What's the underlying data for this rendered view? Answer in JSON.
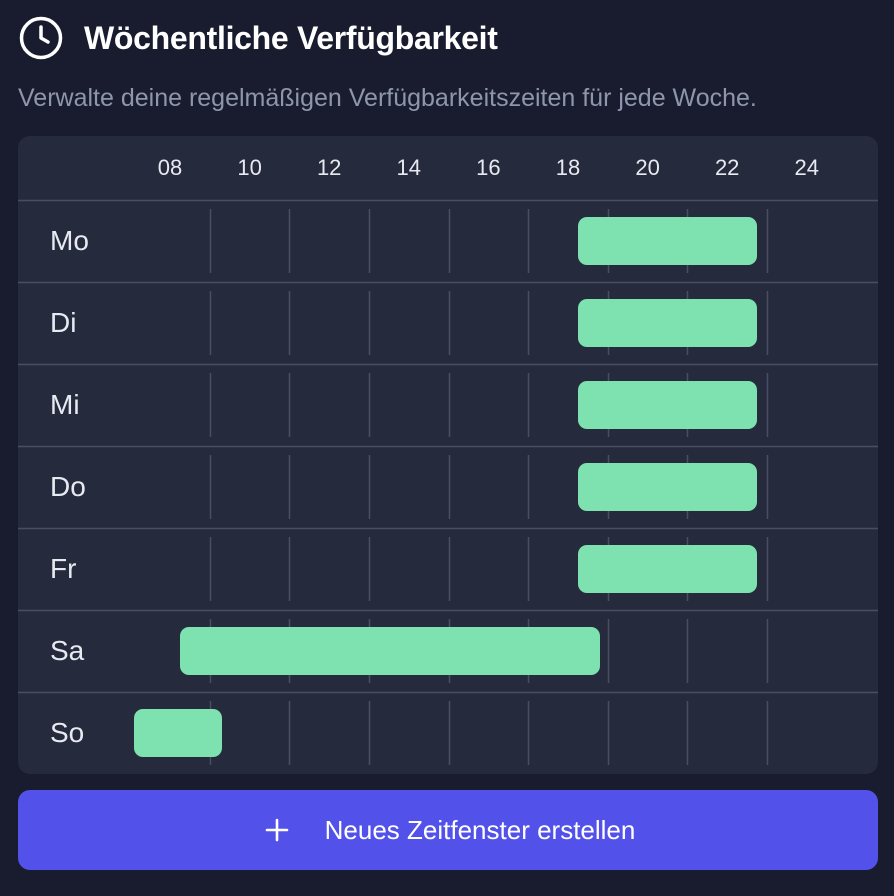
{
  "header": {
    "title": "Wöchentliche Verfügbarkeit",
    "subtitle": "Verwalte deine regelmäßigen Verfügbarkeitszeiten für jede Woche."
  },
  "schedule": {
    "hours": [
      "08",
      "10",
      "12",
      "14",
      "16",
      "18",
      "20",
      "22",
      "24"
    ],
    "days": [
      {
        "label": "Mo",
        "slots": [
          {
            "start": 18.25,
            "end": 22.75
          }
        ]
      },
      {
        "label": "Di",
        "slots": [
          {
            "start": 18.25,
            "end": 22.75
          }
        ]
      },
      {
        "label": "Mi",
        "slots": [
          {
            "start": 18.25,
            "end": 22.75
          }
        ]
      },
      {
        "label": "Do",
        "slots": [
          {
            "start": 18.25,
            "end": 22.75
          }
        ]
      },
      {
        "label": "Fr",
        "slots": [
          {
            "start": 18.25,
            "end": 22.75
          }
        ]
      },
      {
        "label": "Sa",
        "slots": [
          {
            "start": 8.25,
            "end": 18.8
          }
        ]
      },
      {
        "label": "So",
        "slots": [
          {
            "start": 7.1,
            "end": 9.3
          }
        ]
      }
    ],
    "slot_color": "#7ee2b0"
  },
  "actions": {
    "create_label": "Neues Zeitfenster erstellen",
    "button_color": "#5252ea"
  },
  "icons": {
    "header_icon": "clock-icon",
    "button_icon": "plus-icon"
  }
}
